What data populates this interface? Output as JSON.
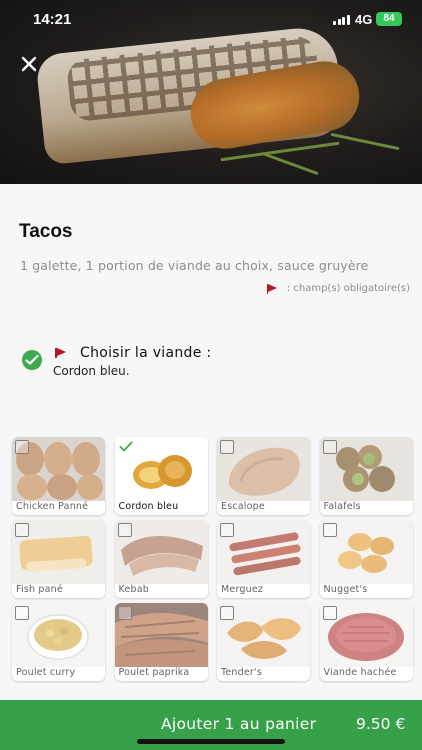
{
  "status_bar": {
    "time": "14:21",
    "network": "4G",
    "battery": "84"
  },
  "product": {
    "title": "Tacos",
    "description": "1 galette, 1 portion de viande au choix, sauce gruyère",
    "required_note": ": champ(s) obligatoire(s)"
  },
  "meat_section": {
    "title": "Choisir la viande :",
    "selected_value": "Cordon bleu."
  },
  "options": [
    {
      "label": "Chicken Panné",
      "selected": false
    },
    {
      "label": "Cordon bleu",
      "selected": true
    },
    {
      "label": "Escalope",
      "selected": false
    },
    {
      "label": "Falafels",
      "selected": false
    },
    {
      "label": "Fish pané",
      "selected": false
    },
    {
      "label": "Kebab",
      "selected": false
    },
    {
      "label": "Merguez",
      "selected": false
    },
    {
      "label": "Nugget's",
      "selected": false
    },
    {
      "label": "Poulet curry",
      "selected": false
    },
    {
      "label": "Poulet paprika",
      "selected": false
    },
    {
      "label": "Tender's",
      "selected": false
    },
    {
      "label": "Viande hachée",
      "selected": false
    }
  ],
  "footer": {
    "add_label": "Ajouter 1 au panier",
    "price": "9.50 €"
  },
  "colors": {
    "accent_green": "#37a14a",
    "flag_red": "#b0182f",
    "check_green": "#3daa50"
  }
}
